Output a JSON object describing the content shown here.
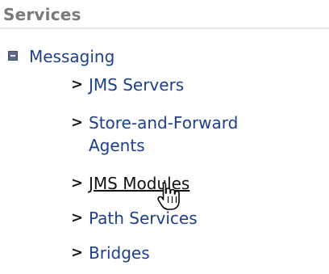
{
  "section": {
    "title": "Services"
  },
  "tree": {
    "parent": {
      "label": "Messaging",
      "icon": "collapse-box-icon",
      "expanded": true
    },
    "children": [
      {
        "label": "JMS Servers",
        "icon": "chevron-right-icon"
      },
      {
        "label": "Store-and-Forward Agents",
        "icon": "chevron-right-icon"
      },
      {
        "label": "JMS Modules",
        "icon": "chevron-right-icon",
        "hovered": true
      },
      {
        "label": "Path Services",
        "icon": "chevron-right-icon"
      },
      {
        "label": "Bridges",
        "icon": "chevron-right-icon"
      }
    ]
  },
  "colors": {
    "link": "#1c3f8f",
    "link_hover": "#111111",
    "section_title": "#7a7a7a",
    "chevron": "#1a1a1a"
  },
  "cursor": {
    "type": "hand-pointer-icon"
  }
}
